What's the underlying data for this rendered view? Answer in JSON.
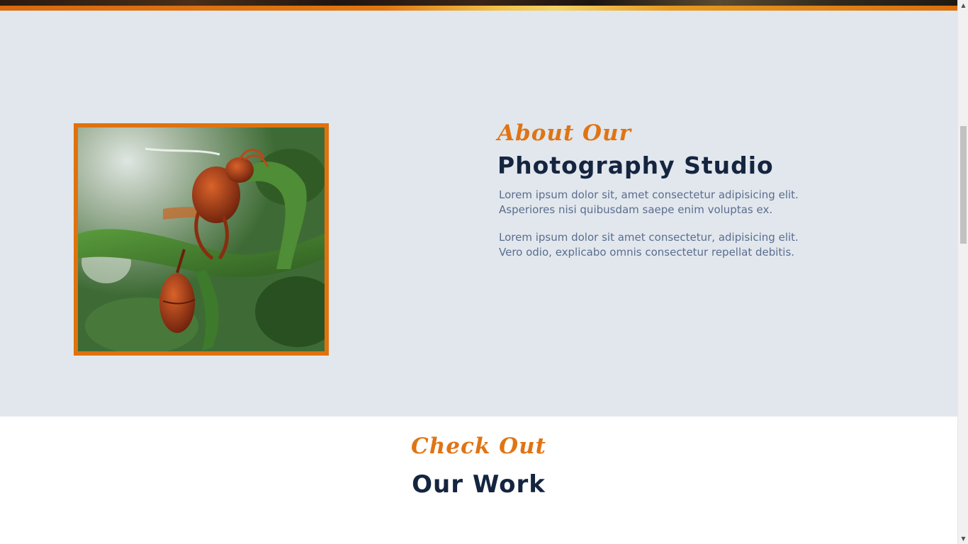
{
  "about": {
    "eyebrow": "About Our",
    "title": "Photography Studio",
    "paragraphs": [
      "Lorem ipsum dolor sit, amet consectetur adipisicing elit. Asperiores nisi quibusdam saepe enim voluptas ex.",
      "Lorem ipsum dolor sit amet consectetur, adipisicing elit. Vero odio, explicabo omnis consectetur repellat debitis."
    ],
    "photo_subject": "wasp on green plant stem",
    "frame_color": "#e0720e"
  },
  "work": {
    "eyebrow": "Check Out",
    "title": "Our Work"
  },
  "colors": {
    "accent": "#e07414",
    "heading": "#152540",
    "body_text": "#5b6d8e",
    "about_bg": "#e1e7ed"
  },
  "scrollbar": {
    "up_icon": "triangle-up-icon",
    "down_icon": "triangle-down-icon"
  }
}
